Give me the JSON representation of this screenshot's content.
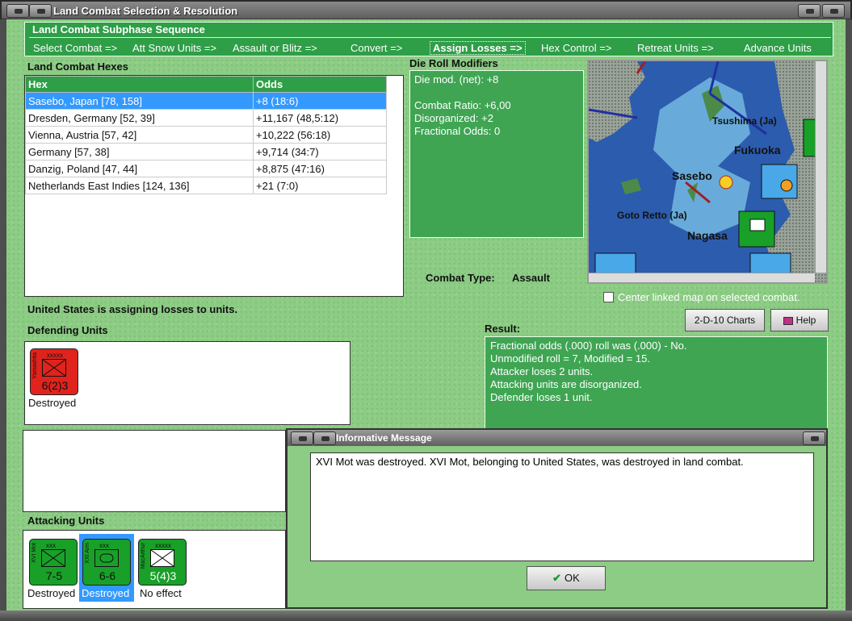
{
  "window": {
    "title": "Land Combat Selection & Resolution"
  },
  "subphase": {
    "title": "Land Combat Subphase Sequence",
    "steps": [
      "Select Combat =>",
      "Att Snow Units =>",
      "Assault or Blitz =>",
      "Convert =>",
      "Assign Losses =>",
      "Hex Control =>",
      "Retreat Units =>",
      "Advance Units"
    ],
    "active_step": "Assign Losses =>"
  },
  "hexes": {
    "label": "Land Combat Hexes",
    "columns": [
      "Hex",
      "Odds"
    ],
    "rows": [
      {
        "hex": "Sasebo, Japan [78, 158]",
        "odds": "+8 (18:6)"
      },
      {
        "hex": "Dresden, Germany [52, 39]",
        "odds": "+11,167 (48,5:12)"
      },
      {
        "hex": "Vienna, Austria [57, 42]",
        "odds": "+10,222 (56:18)"
      },
      {
        "hex": "Germany [57, 38]",
        "odds": "+9,714 (34:7)"
      },
      {
        "hex": "Danzig, Poland [47, 44]",
        "odds": "+8,875 (47:16)"
      },
      {
        "hex": "Netherlands East Indies [124, 136]",
        "odds": "+21 (7:0)"
      }
    ]
  },
  "die_roll": {
    "label": "Die Roll Modifiers",
    "net": "Die mod. (net): +8",
    "lines": [
      "Combat Ratio: +6,00",
      "Disorganized: +2",
      "Fractional Odds: 0"
    ]
  },
  "combat_type": {
    "label": "Combat Type:",
    "value": "Assault"
  },
  "map": {
    "labels": [
      "Tsushima (Ja)",
      "Fukuoka",
      "Sasebo",
      "Goto Retto (Ja)",
      "Nagasa"
    ],
    "center_checkbox": "Center linked map on selected combat.",
    "center_checked": false
  },
  "status": "United States is assigning losses to units.",
  "defending": {
    "label": "Defending Units",
    "units": [
      {
        "name": "Yamashita",
        "size": "xxxxx",
        "strength": "6(2)3",
        "status": "Destroyed",
        "color": "#e0231c"
      }
    ]
  },
  "buttons": {
    "charts": "2-D-10 Charts",
    "help": "Help",
    "ok": "OK"
  },
  "result": {
    "label": "Result:",
    "lines": [
      "Fractional odds (.000) roll was (.000)  - No.",
      "Unmodified roll = 7, Modified = 15.",
      "Attacker loses 2 units.",
      "Attacking units are disorganized.",
      "Defender loses 1 unit."
    ]
  },
  "attacking": {
    "label": "Attacking Units",
    "units": [
      {
        "name": "XVI Mot",
        "size": "xxx",
        "strength": "7-5",
        "status": "Destroyed",
        "color": "#18a028"
      },
      {
        "name": "XXI Arm",
        "size": "xxx",
        "strength": "6-6",
        "status": "Destroyed",
        "color": "#18a028"
      },
      {
        "name": "MacArthur",
        "size": "xxxxx",
        "strength": "5(4)3",
        "status": "No effect",
        "color": "#18a028"
      }
    ]
  },
  "message": {
    "title": "Informative Message",
    "text": "XVI Mot was destroyed.  XVI Mot, belonging to United States, was destroyed in land combat."
  }
}
